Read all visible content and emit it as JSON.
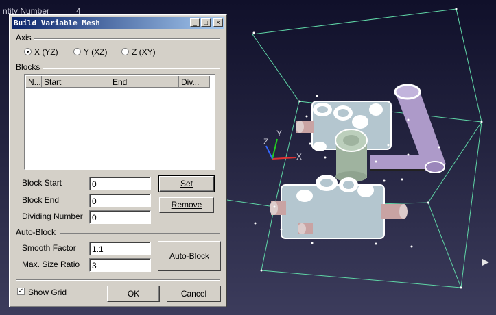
{
  "hud": {
    "entity_label": "ntity Number",
    "entity_value": "4"
  },
  "axes_gizmo": {
    "z": "Z",
    "y": "Y",
    "x": "X"
  },
  "dialog": {
    "title": "Build Variable Mesh",
    "buttons": {
      "minimize": "_",
      "maximize": "□",
      "close": "×"
    },
    "axis": {
      "group_label": "Axis",
      "options": [
        {
          "label": "X (YZ)",
          "selected": true
        },
        {
          "label": "Y (XZ)",
          "selected": false
        },
        {
          "label": "Z (XY)",
          "selected": false
        }
      ]
    },
    "blocks": {
      "group_label": "Blocks",
      "columns": [
        "N...",
        "Start",
        "End",
        "Div..."
      ],
      "rows": []
    },
    "fields": {
      "block_start_label": "Block Start",
      "block_start_value": "0",
      "block_end_label": "Block End",
      "block_end_value": "0",
      "dividing_label": "Dividing Number",
      "dividing_value": "0"
    },
    "set_label": "Set",
    "remove_label": "Remove",
    "auto_block": {
      "group_label": "Auto-Block",
      "smooth_label": "Smooth Factor",
      "smooth_value": "1.1",
      "ratio_label": "Max. Size Ratio",
      "ratio_value": "3",
      "button_label": "Auto-Block"
    },
    "show_grid_label": "Show Grid",
    "show_grid_checked": true,
    "ok_label": "OK",
    "cancel_label": "Cancel"
  },
  "colors": {
    "bounding_box": "#5fd6a6",
    "part_body": "#b4c6cf",
    "part_cylinder_purple": "#ad9ac9",
    "part_cylinder_green": "#9fb39f",
    "part_pin_pink": "#c9a3a3",
    "titlebar": "#0a246a"
  }
}
